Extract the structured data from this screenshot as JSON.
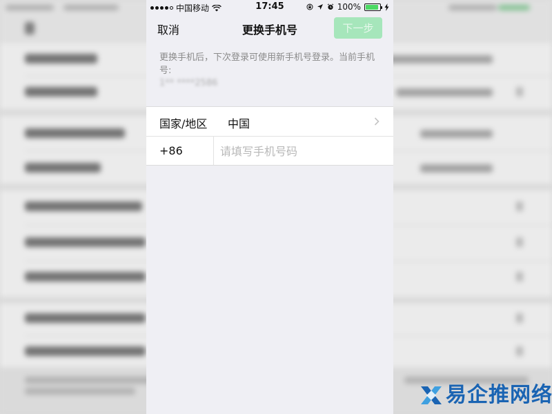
{
  "status_bar": {
    "carrier": "中国移动",
    "time": "17:45",
    "battery_percent": "100%",
    "battery_level": 1.0,
    "signal_bars": 4,
    "icons": [
      "signal-icon",
      "wifi-icon",
      "lock-rotation-icon",
      "location-icon",
      "alarm-icon",
      "battery-icon",
      "charging-bolt-icon"
    ]
  },
  "nav": {
    "cancel_label": "取消",
    "title": "更换手机号",
    "next_label": "下一步"
  },
  "notice": {
    "text": "更换手机后，下次登录可使用新手机号登录。当前手机号:",
    "current_number_masked": "1** ****2586"
  },
  "form": {
    "country_label": "国家/地区",
    "country_value": "中国",
    "dial_code": "+86",
    "phone_placeholder": "请填写手机号码",
    "phone_value": ""
  },
  "colors": {
    "accent_disabled": "#a6e6bb",
    "panel_background": "#efeff4",
    "watermark_blue": "#1a64b3"
  },
  "watermark": {
    "text": "易企推网络"
  }
}
